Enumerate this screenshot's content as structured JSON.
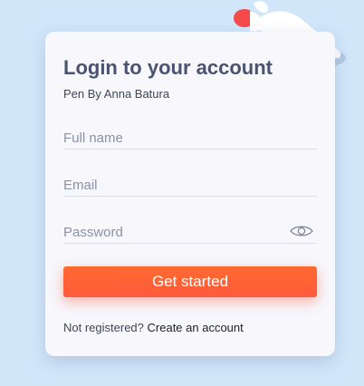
{
  "card": {
    "title": "Login to your account",
    "subtitle": "Pen By Anna Batura"
  },
  "form": {
    "full_name_placeholder": "Full name",
    "email_placeholder": "Email",
    "password_placeholder": "Password",
    "submit_label": "Get started"
  },
  "footer": {
    "prompt": "Not registered?",
    "link": "Create an account"
  },
  "icons": {
    "password_toggle": "eye-icon",
    "decoration": "fish-illustration"
  },
  "colors": {
    "background": "#d2e6fa",
    "card": "#f7f7fc",
    "title": "#4a5370",
    "accent": "#ff6a2f",
    "fish": "#f44a4a"
  }
}
